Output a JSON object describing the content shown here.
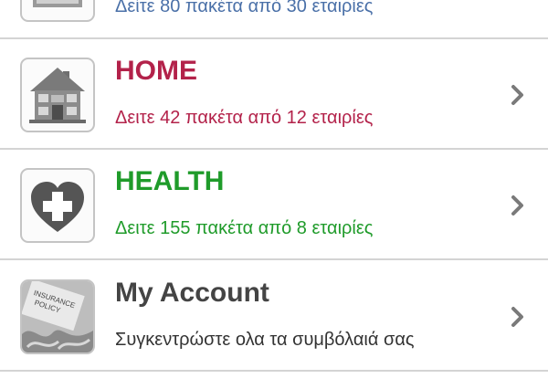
{
  "rows": [
    {
      "key": "previous",
      "subtitle": "Δείτε 80 πακέτα από 30 εταιρίες"
    },
    {
      "key": "home",
      "title": "HOME",
      "subtitle": "Δειτε 42 πακέτα από 12 εταιρίες",
      "icon": "house-icon"
    },
    {
      "key": "health",
      "title": "HEALTH",
      "subtitle": "Δειτε 155 πακέτα από 8 εταιρίες",
      "icon": "heart-cross-icon"
    },
    {
      "key": "account",
      "title": "My Account",
      "subtitle": "Συγκεντρώστε ολα τα συμβόλαιά σας",
      "icon": "insurance-policy-photo-icon",
      "icon_text": "INSURANCE POLICY"
    }
  ],
  "colors": {
    "home": "#b3224a",
    "health": "#1f9b2a",
    "account_title": "#444444",
    "link_blue": "#4a70a8",
    "divider": "#d4d4d4"
  }
}
